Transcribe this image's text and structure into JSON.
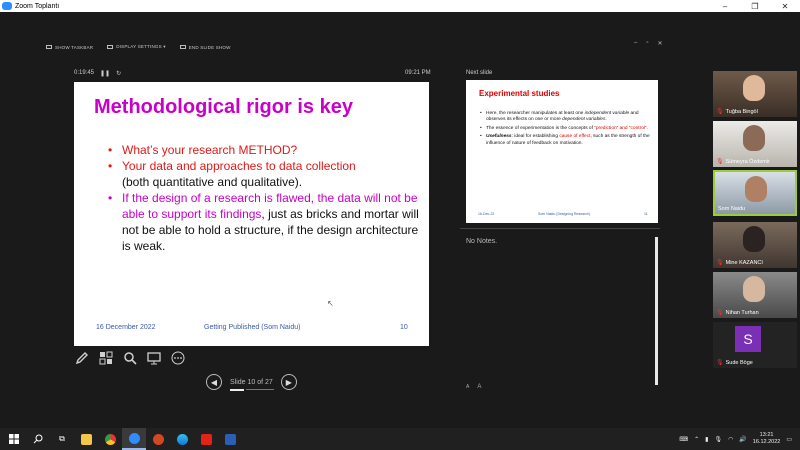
{
  "window": {
    "title": "Zoom Toplantı"
  },
  "presenter_toolbar": {
    "show_taskbar": "SHOW TASKBAR",
    "display_settings": "DISPLAY SETTINGS ▾",
    "end_slide_show": "END SLIDE SHOW"
  },
  "timer": {
    "elapsed": "0:19:45",
    "clock": "09:21 PM"
  },
  "current_slide": {
    "title": "Methodological rigor is key",
    "bullet1": "What’s your research METHOD?",
    "bullet2_red": "Your data and approaches to data collection",
    "bullet2_black": "(both quantitative and qualitative).",
    "bullet3_magenta": "If the design of a research is flawed, the data will not be able to support its findings",
    "bullet3_black": ", just as bricks and mortar will not be able to hold a structure, if the design architecture is weak.",
    "footer_date": "16 December 2022",
    "footer_center": "Getting Published (Som Naidu)",
    "footer_page": "10"
  },
  "slide_nav": {
    "label": "Slide 10 of 27"
  },
  "next_slide": {
    "label": "Next slide",
    "title": "Experimental studies",
    "b1_a": "Here, the researcher manipulates at least one ",
    "b1_i1": "independent variable",
    "b1_b": " and observes its effects on one or more ",
    "b1_i2": "dependent variables",
    "b1_c": ".",
    "b2_a": "The essence of experimentation is the concepts of ",
    "b2_red": "“prediction” and “control”",
    "b2_c": ".",
    "b3_i": "Usefulness",
    "b3_a": ": ideal for establishing ",
    "b3_red": "cause of effect",
    "b3_b": ", such as the strength of the influence of nature of feedback on motivation.",
    "footer_date": "16-Dec-22",
    "footer_center": "Som Naidu (Designing Research)",
    "footer_page": "11"
  },
  "notes": {
    "text": "No Notes.",
    "size_small": "A",
    "size_large": "A"
  },
  "participants": [
    {
      "name": "Tuğba Bingöl"
    },
    {
      "name": "Sümeyra Özdemir"
    },
    {
      "name": "Som Naidu"
    },
    {
      "name": "Mine KAZANCI"
    },
    {
      "name": "Nihan Turhan"
    },
    {
      "name": "Sude Böge",
      "initial": "S"
    }
  ],
  "taskbar": {
    "time": "13:21",
    "date": "16.12.2022"
  }
}
